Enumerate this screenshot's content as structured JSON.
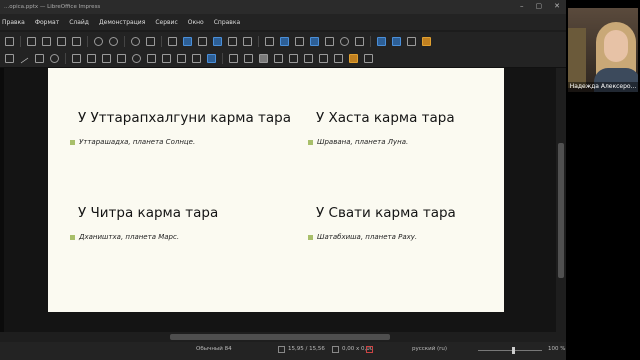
{
  "window": {
    "title": "...opica.pptx — LibreOffice Impress",
    "controls": [
      "–",
      "▢",
      "✕"
    ]
  },
  "menu": [
    "Правка",
    "Формат",
    "Слайд",
    "Демонстрация",
    "Сервис",
    "Окно",
    "Справка"
  ],
  "toolbar": {
    "row1_icons": [
      "display-views-icon",
      "cut-icon",
      "copy-icon",
      "paste-icon",
      "clone-formatting-icon",
      "undo-icon",
      "redo-icon",
      "find-replace-icon",
      "spelling-icon",
      "normal-view-icon",
      "outline-view-icon",
      "notes-view-icon",
      "slide-sorter-icon",
      "master-slide-icon",
      "new-slide-icon",
      "table-icon",
      "image-icon",
      "media-icon",
      "chart-icon",
      "textbox-icon",
      "special-character-icon",
      "fontwork-icon",
      "transitions-icon",
      "animation-icon",
      "show-draw-functions-icon"
    ],
    "row2_icons": [
      "select-icon",
      "line-icon",
      "rectangle-icon",
      "ellipse-icon",
      "lines-arrows-icon",
      "curves-icon",
      "connectors-icon",
      "basic-shapes-icon",
      "symbol-shapes-icon",
      "block-arrows-icon",
      "flowchart-icon",
      "callouts-icon",
      "stars-icon",
      "3d-objects-icon",
      "rotate-icon",
      "align-icon",
      "arrange-icon",
      "distribute-icon",
      "shadow-icon",
      "crop-icon",
      "filter-icon",
      "toggle-extrusion-icon",
      "points-icon",
      "glue-points-icon"
    ]
  },
  "slide": {
    "background": "#fbfaf1",
    "bullet_color": "#a8bf6a",
    "items": [
      {
        "heading": "У Уттарапхалгуни карма тара",
        "text": "Уттарашадха, планета Солнце."
      },
      {
        "heading": "У Хаста карма тара",
        "text": "Шравана, планета Луна."
      },
      {
        "heading": "У Читра карма тара",
        "text": "Дхаништха, планета Марс."
      },
      {
        "heading": "У Свати карма тара",
        "text": "Шатабхиша, планета Раху."
      }
    ]
  },
  "status": {
    "layout": "Обычный 84",
    "position": "15,95 / 15,56",
    "size": "0,00 x 0,00",
    "language": "русский (ru)",
    "zoom": "100 %",
    "zoom_level": 0.55
  },
  "video": {
    "participant_name": "Надежда Алексеро..."
  }
}
